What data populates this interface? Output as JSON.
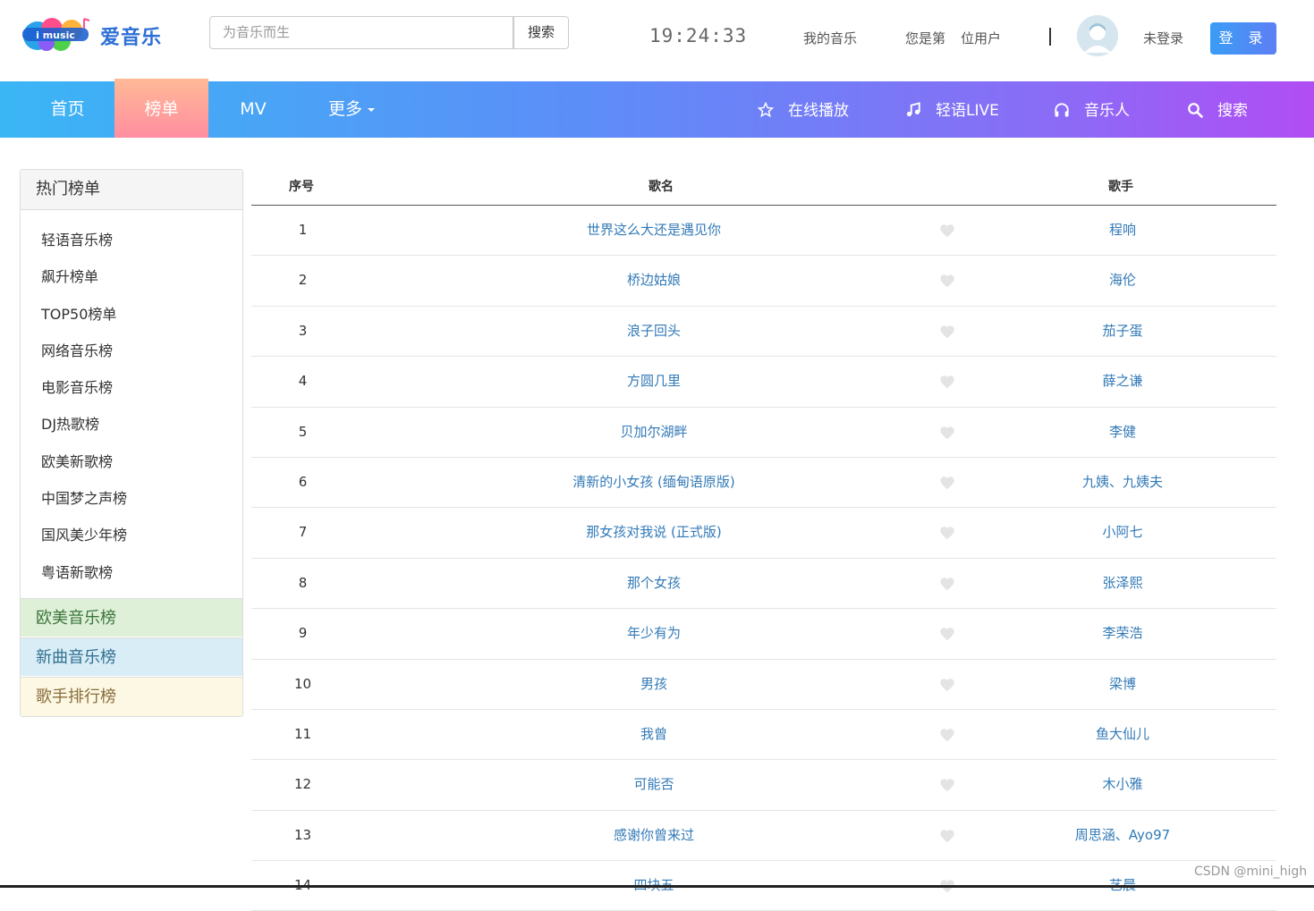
{
  "header": {
    "logo_badge": "i music",
    "logo_text": "爱音乐",
    "search_placeholder": "为音乐而生",
    "search_button": "搜索",
    "clock": "19:24:33",
    "my_music": "我的音乐",
    "visitor_prefix": "您是第",
    "visitor_suffix": "位用户",
    "user_status": "未登录",
    "login_button": "登 录"
  },
  "nav": {
    "left": [
      "首页",
      "榜单",
      "MV",
      "更多"
    ],
    "active_index": 1,
    "right": [
      {
        "label": "在线播放",
        "icon": "star-icon"
      },
      {
        "label": "轻语LIVE",
        "icon": "music-note-icon"
      },
      {
        "label": "音乐人",
        "icon": "headphones-icon"
      },
      {
        "label": "搜索",
        "icon": "search-icon"
      }
    ]
  },
  "sidebar": {
    "title": "热门榜单",
    "items": [
      "轻语音乐榜",
      "飙升榜单",
      "TOP50榜单",
      "网络音乐榜",
      "电影音乐榜",
      "DJ热歌榜",
      "欧美新歌榜",
      "中国梦之声榜",
      "国风美少年榜",
      "粤语新歌榜"
    ],
    "blocks": [
      "欧美音乐榜",
      "新曲音乐榜",
      "歌手排行榜"
    ]
  },
  "table": {
    "headers": {
      "no": "序号",
      "song": "歌名",
      "singer": "歌手"
    },
    "rows": [
      {
        "no": "1",
        "song": "世界这么大还是遇见你",
        "singer": "程响"
      },
      {
        "no": "2",
        "song": "桥边姑娘",
        "singer": "海伦"
      },
      {
        "no": "3",
        "song": "浪子回头",
        "singer": "茄子蛋"
      },
      {
        "no": "4",
        "song": "方圆几里",
        "singer": "薛之谦"
      },
      {
        "no": "5",
        "song": "贝加尔湖畔",
        "singer": "李健"
      },
      {
        "no": "6",
        "song": "清新的小女孩 (缅甸语原版)",
        "singer": "九姨、九姨夫"
      },
      {
        "no": "7",
        "song": "那女孩对我说 (正式版)",
        "singer": "小阿七"
      },
      {
        "no": "8",
        "song": "那个女孩",
        "singer": "张泽熙"
      },
      {
        "no": "9",
        "song": "年少有为",
        "singer": "李荣浩"
      },
      {
        "no": "10",
        "song": "男孩",
        "singer": "梁博"
      },
      {
        "no": "11",
        "song": "我曾",
        "singer": "鱼大仙儿"
      },
      {
        "no": "12",
        "song": "可能否",
        "singer": "木小雅"
      },
      {
        "no": "13",
        "song": "感谢你曾来过",
        "singer": "周思涵、Ayo97"
      },
      {
        "no": "14",
        "song": "四块五",
        "singer": "艺晨"
      }
    ]
  },
  "watermark": "CSDN @mini_high",
  "colors": {
    "link": "#337ab7",
    "nav_start": "#3ab6f5",
    "nav_end": "#b14df4",
    "active_tab": "#ff9d9e"
  }
}
